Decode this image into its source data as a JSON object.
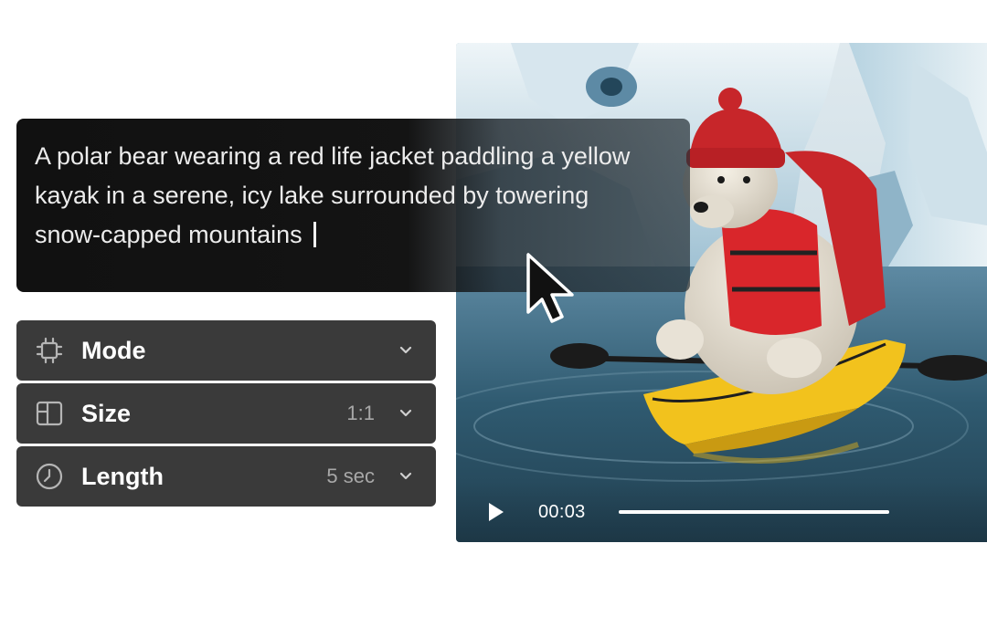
{
  "prompt": {
    "text": "A polar bear wearing a red life jacket paddling a yellow kayak in a serene, icy lake surrounded by towering snow-capped mountains"
  },
  "settings": [
    {
      "label": "Mode",
      "value": "",
      "icon": "chip-icon"
    },
    {
      "label": "Size",
      "value": "1:1",
      "icon": "aspect-ratio-icon"
    },
    {
      "label": "Length",
      "value": "5 sec",
      "icon": "clock-icon"
    }
  ],
  "video": {
    "time": "00:03",
    "progress": 1.0
  },
  "colors": {
    "prompt_bg": "#0c0c0c",
    "setting_bg": "#3a3a3a",
    "setting_value": "#a8a8a8",
    "kayak": "#f2c21d",
    "life_jacket": "#d9262b"
  }
}
